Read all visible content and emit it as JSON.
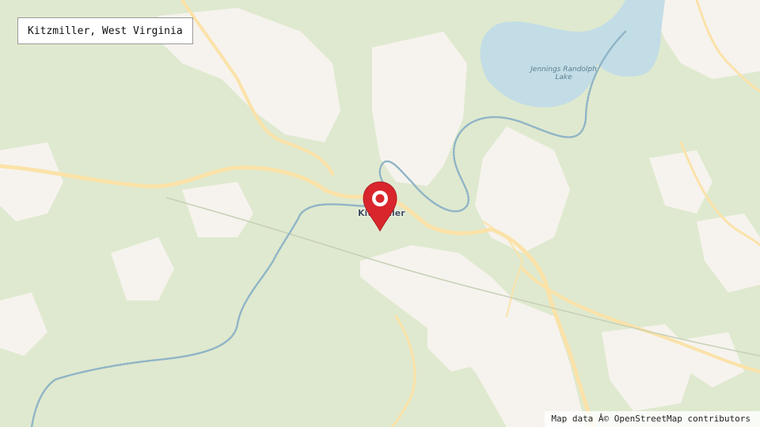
{
  "map": {
    "location_label": "Kitzmiller, West Virginia",
    "place_labels": {
      "town": "Kitzmiller",
      "lake": "Jennings Randolph Lake"
    },
    "attribution": "Map data Â© OpenStreetMap contributors",
    "marker_icon": "location-pin-icon",
    "colors": {
      "forest": "#dfe9cf",
      "developed": "#f6f3ee",
      "water": "#c3dde6",
      "river_line": "#7fa7bb",
      "road": "#fbe2a8",
      "marker": "#d9262c"
    }
  }
}
